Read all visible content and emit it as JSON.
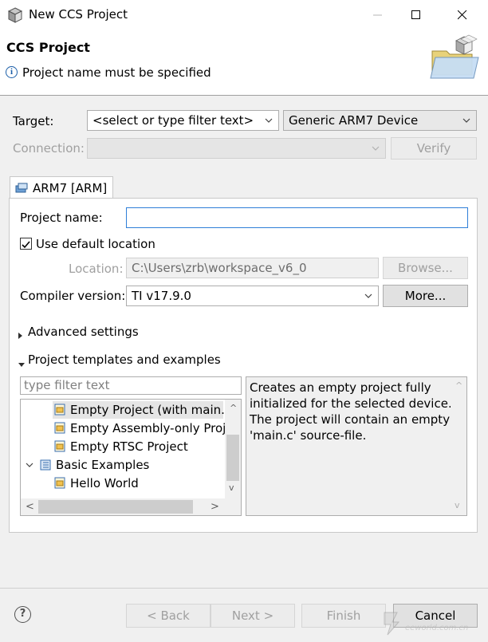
{
  "window": {
    "title": "New CCS Project"
  },
  "header": {
    "title": "CCS Project",
    "message": "Project name must be specified"
  },
  "target": {
    "label": "Target:",
    "filter_value": "<select or type filter text>",
    "device_value": "Generic ARM7 Device"
  },
  "connection": {
    "label": "Connection:",
    "value": "",
    "verify_label": "Verify"
  },
  "tab": {
    "label": "ARM7 [ARM]"
  },
  "project": {
    "name_label": "Project name:",
    "name_value": "",
    "use_default_label": "Use default location",
    "use_default_checked": true,
    "location_label": "Location:",
    "location_value": "C:\\Users\\zrb\\workspace_v6_0",
    "browse_label": "Browse...",
    "compiler_label": "Compiler version:",
    "compiler_value": "TI v17.9.0",
    "more_label": "More..."
  },
  "sections": {
    "advanced": "Advanced settings",
    "templates": "Project templates and examples"
  },
  "templates": {
    "filter_placeholder": "type filter text",
    "items": [
      {
        "label": "Empty Project (with main.c"
      },
      {
        "label": "Empty Assembly-only Proj"
      },
      {
        "label": "Empty RTSC Project"
      },
      {
        "label": "Basic Examples"
      },
      {
        "label": "Hello World"
      }
    ],
    "description": [
      "Creates an empty project fully",
      "initialized for the selected device.",
      "The project will contain an empty",
      "'main.c' source-file."
    ]
  },
  "footer": {
    "back_label": "< Back",
    "next_label": "Next >",
    "finish_label": "Finish",
    "cancel_label": "Cancel",
    "watermark_text": "eeworld.com.cn"
  },
  "colors": {
    "accent": "#2f7fd8",
    "selection": "#e5e5e5",
    "disabled_text": "#a0a0a0"
  }
}
